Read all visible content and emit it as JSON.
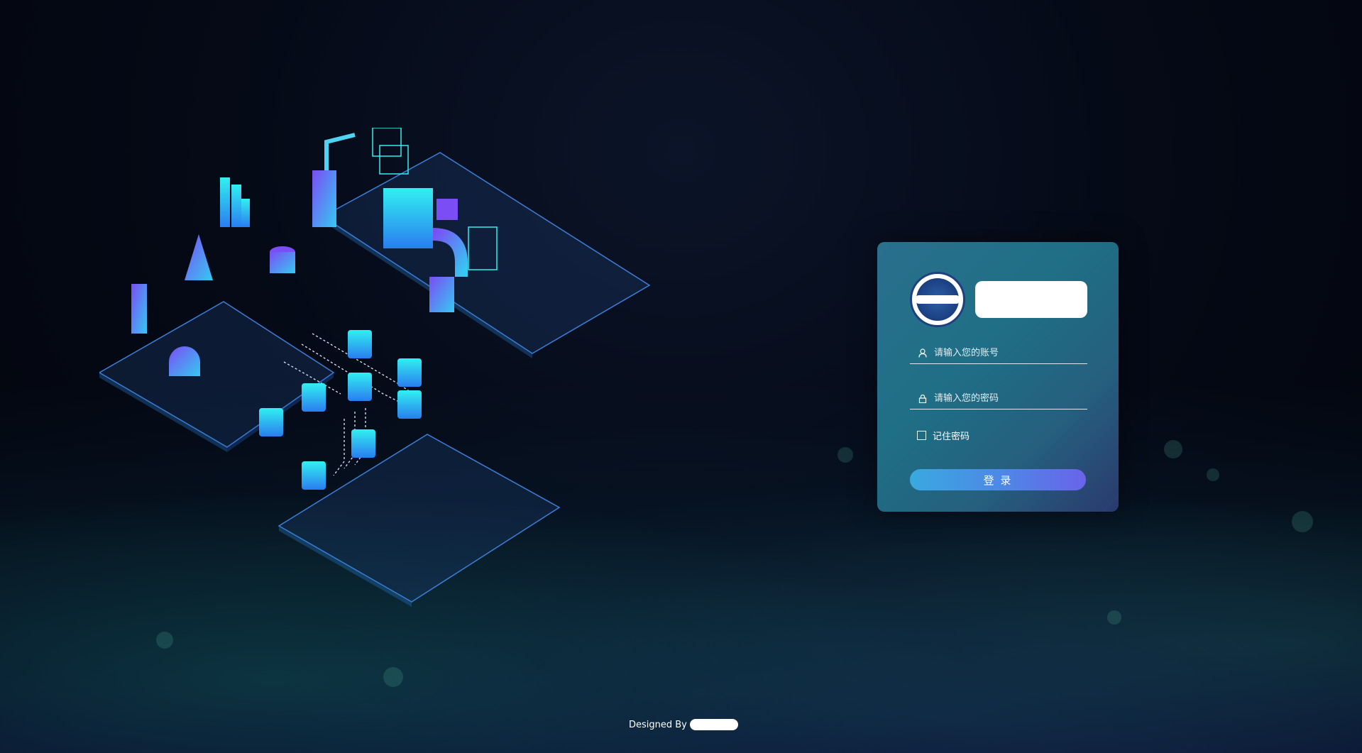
{
  "login": {
    "username_placeholder": "请输入您的账号",
    "password_placeholder": "请输入您的密码",
    "remember_label": "记住密码",
    "submit_label": "登 录"
  },
  "footer": {
    "text": "Designed By"
  },
  "colors": {
    "background": "#050a17",
    "card_start": "#2a6f8e",
    "card_end": "#2a3a6e",
    "button_start": "#3aa9e0",
    "button_end": "#6a63ea",
    "illustration_cyan": "#28e0e6",
    "illustration_purple": "#6a4cf0"
  },
  "icons": {
    "username": "user-icon",
    "password": "lock-icon"
  }
}
